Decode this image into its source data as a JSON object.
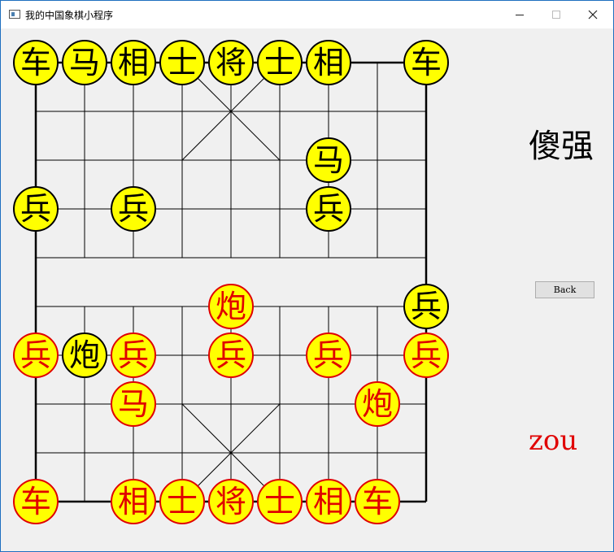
{
  "window": {
    "title": "我的中国象棋小程序"
  },
  "side_panel": {
    "player_name": "傻强",
    "back_label": "Back",
    "turn_text": "zou"
  },
  "colors": {
    "piece_fill": "#ffff00",
    "black_side": "#000000",
    "red_side": "#e00000",
    "grid_line": "#000000",
    "background": "#f0f0f0"
  },
  "board": {
    "columns": 9,
    "rows": 10,
    "pieces": [
      {
        "char": "车",
        "side": "black",
        "col": 0,
        "row": 0
      },
      {
        "char": "马",
        "side": "black",
        "col": 1,
        "row": 0
      },
      {
        "char": "相",
        "side": "black",
        "col": 2,
        "row": 0
      },
      {
        "char": "士",
        "side": "black",
        "col": 3,
        "row": 0
      },
      {
        "char": "将",
        "side": "black",
        "col": 4,
        "row": 0
      },
      {
        "char": "士",
        "side": "black",
        "col": 5,
        "row": 0
      },
      {
        "char": "相",
        "side": "black",
        "col": 6,
        "row": 0
      },
      {
        "char": "车",
        "side": "black",
        "col": 8,
        "row": 0
      },
      {
        "char": "马",
        "side": "black",
        "col": 6,
        "row": 2
      },
      {
        "char": "兵",
        "side": "black",
        "col": 0,
        "row": 3
      },
      {
        "char": "兵",
        "side": "black",
        "col": 2,
        "row": 3
      },
      {
        "char": "兵",
        "side": "black",
        "col": 6,
        "row": 3
      },
      {
        "char": "兵",
        "side": "black",
        "col": 8,
        "row": 5
      },
      {
        "char": "炮",
        "side": "black",
        "col": 1,
        "row": 6
      },
      {
        "char": "炮",
        "side": "red",
        "col": 4,
        "row": 5
      },
      {
        "char": "兵",
        "side": "red",
        "col": 0,
        "row": 6
      },
      {
        "char": "兵",
        "side": "red",
        "col": 2,
        "row": 6
      },
      {
        "char": "兵",
        "side": "red",
        "col": 4,
        "row": 6
      },
      {
        "char": "兵",
        "side": "red",
        "col": 6,
        "row": 6
      },
      {
        "char": "兵",
        "side": "red",
        "col": 8,
        "row": 6
      },
      {
        "char": "马",
        "side": "red",
        "col": 2,
        "row": 7
      },
      {
        "char": "炮",
        "side": "red",
        "col": 7,
        "row": 7
      },
      {
        "char": "车",
        "side": "red",
        "col": 0,
        "row": 9
      },
      {
        "char": "相",
        "side": "red",
        "col": 2,
        "row": 9
      },
      {
        "char": "士",
        "side": "red",
        "col": 3,
        "row": 9
      },
      {
        "char": "将",
        "side": "red",
        "col": 4,
        "row": 9
      },
      {
        "char": "士",
        "side": "red",
        "col": 5,
        "row": 9
      },
      {
        "char": "相",
        "side": "red",
        "col": 6,
        "row": 9
      },
      {
        "char": "车",
        "side": "red",
        "col": 7,
        "row": 9
      }
    ]
  }
}
